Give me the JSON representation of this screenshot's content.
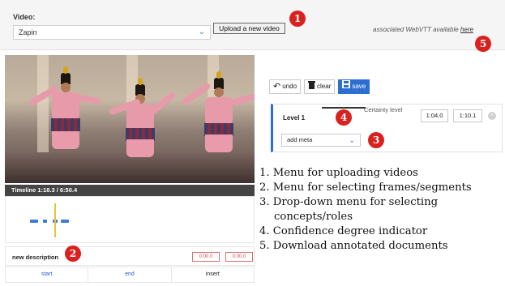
{
  "header": {
    "video_label": "Video:",
    "video_selected": "Zapin",
    "upload_button": "Upload a new video",
    "webvtt_text": "associated WebVTT available",
    "webvtt_link": "here"
  },
  "badges": [
    "1",
    "2",
    "3",
    "4",
    "5"
  ],
  "timeline": {
    "label": "Timeline 1:18.3 / 6:50.4"
  },
  "description": {
    "label": "new description",
    "start_time": "0:00.0",
    "end_time": "0:00.0"
  },
  "segment_buttons": [
    "start",
    "end",
    "insert"
  ],
  "toolbar": {
    "undo_label": "undo",
    "clear_label": "clear",
    "save_label": "save"
  },
  "level": {
    "label": "Level 1",
    "certainty_label": "Certainty level",
    "start": "1:04.0",
    "end": "1:10.1",
    "close": "×",
    "meta_placeholder": "add meta"
  },
  "legend": [
    "1. Menu for uploading videos",
    "2. Menu for selecting frames/segments",
    "3. Drop-down menu for selecting",
    "concepts/roles",
    "4. Confidence degree indicator",
    "5. Download annotated documents"
  ],
  "colors": {
    "accent": "#2d6fd1",
    "badge": "#d9221f",
    "time_box_border": "#e46a6a"
  }
}
